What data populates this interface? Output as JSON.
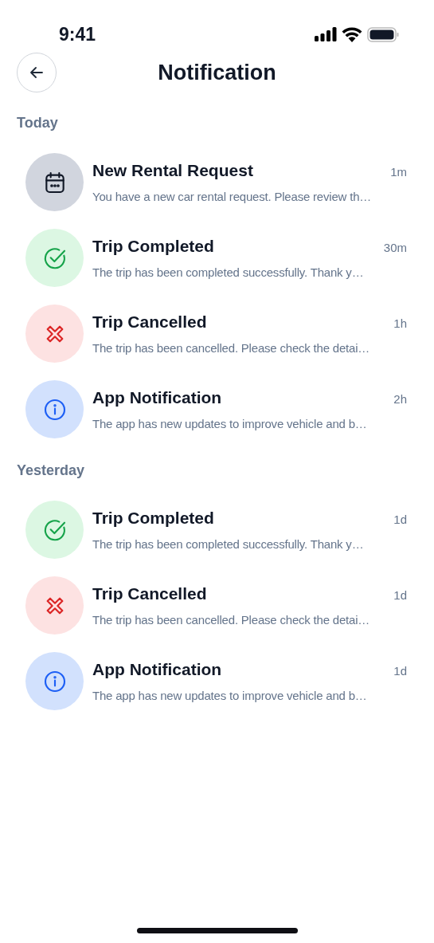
{
  "status_bar": {
    "time": "9:41"
  },
  "header": {
    "title": "Notification"
  },
  "sections": [
    {
      "label": "Today",
      "items": [
        {
          "kind": "request",
          "title": "New Rental Request",
          "time": "1m",
          "message": "You have a new car rental request. Please review th…"
        },
        {
          "kind": "completed",
          "title": "Trip Completed",
          "time": "30m",
          "message": "The trip has been completed successfully. Thank y…"
        },
        {
          "kind": "cancelled",
          "title": "Trip Cancelled",
          "time": "1h",
          "message": "The trip has been cancelled. Please check the detai…"
        },
        {
          "kind": "info",
          "title": "App Notification",
          "time": "2h",
          "message": "The app has new updates to improve vehicle and b…"
        }
      ]
    },
    {
      "label": "Yesterday",
      "items": [
        {
          "kind": "completed",
          "title": "Trip Completed",
          "time": "1d",
          "message": "The trip has been completed successfully. Thank y…"
        },
        {
          "kind": "cancelled",
          "title": "Trip Cancelled",
          "time": "1d",
          "message": "The trip has been cancelled. Please check the detai…"
        },
        {
          "kind": "info",
          "title": "App Notification",
          "time": "1d",
          "message": "The app has new updates to improve vehicle and b…"
        }
      ]
    }
  ]
}
